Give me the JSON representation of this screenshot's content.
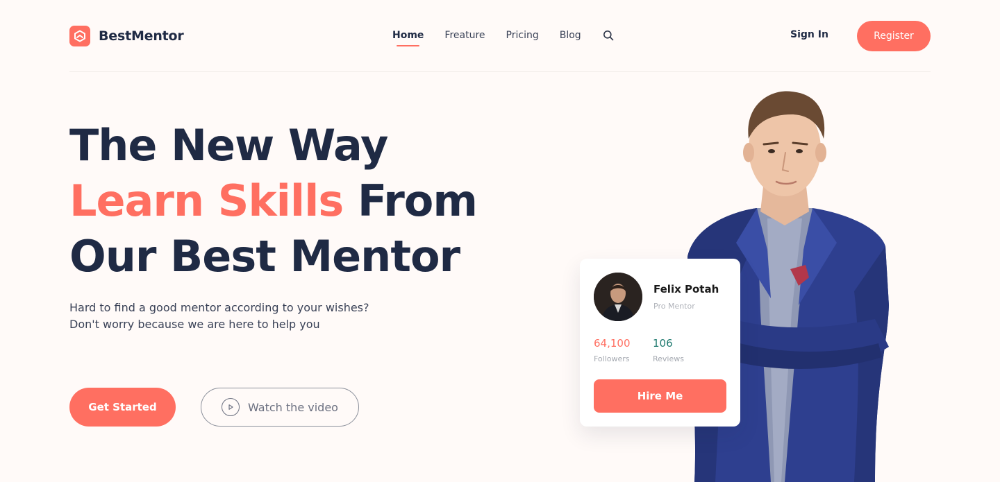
{
  "brand": {
    "name": "BestMentor",
    "accent_color": "#ff6f61",
    "dark_color": "#1f2a44"
  },
  "nav": {
    "items": [
      {
        "label": "Home",
        "active": true
      },
      {
        "label": "Freature",
        "active": false
      },
      {
        "label": "Pricing",
        "active": false
      },
      {
        "label": "Blog",
        "active": false
      }
    ],
    "search_icon": "search-icon",
    "signin_label": "Sign In",
    "register_label": "Register"
  },
  "hero": {
    "headline_line1": "The New Way",
    "headline_accent": "Learn Skills",
    "headline_line2_rest": " From",
    "headline_line3": "Our Best Mentor",
    "subtitle_line1": "Hard to find a good mentor according to your wishes?",
    "subtitle_line2": "Don't worry because we are here to help you",
    "cta_primary": "Get Started",
    "cta_secondary": "Watch the video",
    "cta_secondary_icon": "play-circle-icon"
  },
  "mentor_card": {
    "name": "Felix Potah",
    "role": "Pro Mentor",
    "stats": [
      {
        "value": "64,100",
        "label": "Followers",
        "color": "#ff6f61"
      },
      {
        "value": "106",
        "label": "Reviews",
        "color": "#1f7a6f"
      }
    ],
    "hire_label": "Hire Me"
  }
}
